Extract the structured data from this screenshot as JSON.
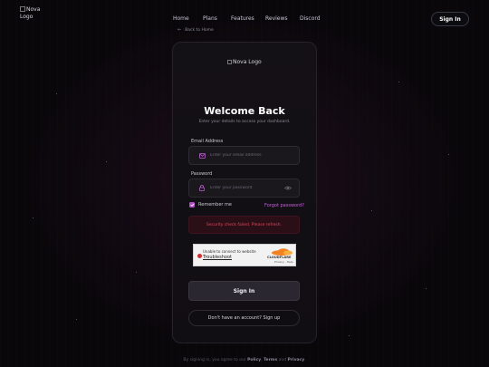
{
  "header": {
    "logo_alt": "Nova Logo",
    "nav": [
      {
        "label": "Home"
      },
      {
        "label": "Plans"
      },
      {
        "label": "Features"
      },
      {
        "label": "Reviews"
      },
      {
        "label": "Discord"
      }
    ],
    "signin_label": "Sign In"
  },
  "back_link": "Back to Home",
  "card": {
    "logo_alt": "Nova Logo",
    "title": "Welcome Back",
    "subtitle": "Enter your details to access your dashboard.",
    "email": {
      "label": "Email Address",
      "placeholder": "Enter your email address",
      "value": ""
    },
    "password": {
      "label": "Password",
      "placeholder": "Enter your password",
      "value": ""
    },
    "remember_label": "Remember me",
    "remember_checked": true,
    "forgot_label": "Forgot password?",
    "error_text": "Security check failed. Please refresh.",
    "captcha": {
      "line1": "Unable to connect to website",
      "line2": "Troubleshoot",
      "brand": "CLOUDFLARE",
      "privacy": "Privacy",
      "help": "Help"
    },
    "submit_label": "Sign In",
    "signup_label": "Don't have an account? Sign up"
  },
  "footer": {
    "prefix": "By signing in, you agree to our",
    "policy": "Policy",
    "terms": "Terms",
    "and": "and",
    "privacy": "Privacy"
  },
  "colors": {
    "accent": "#b04cc4",
    "link": "#c060d6",
    "error": "#e04860",
    "background": "#0a070b"
  },
  "icons": {
    "email": "envelope-icon",
    "password": "lock-icon",
    "toggle": "eye-icon",
    "back": "arrow-left-icon",
    "error": "error-dot-icon",
    "brand": "cloud-icon"
  }
}
